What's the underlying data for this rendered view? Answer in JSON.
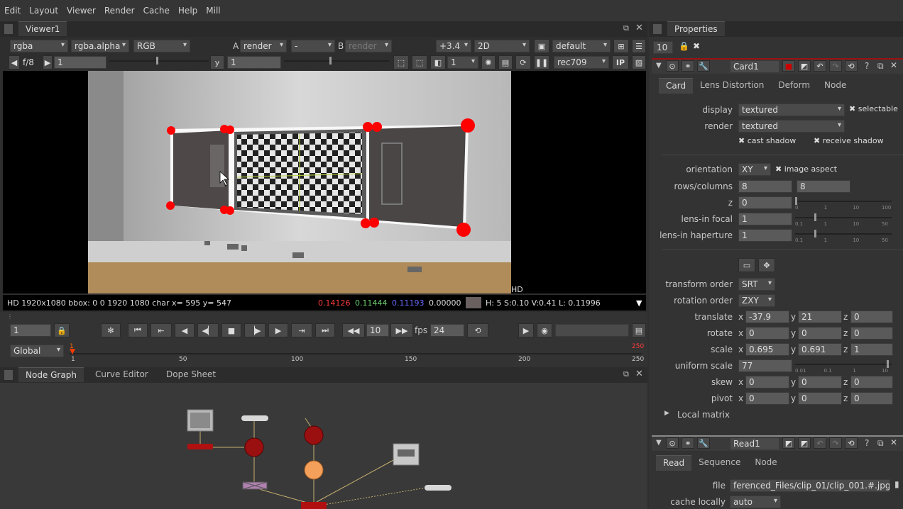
{
  "menu": [
    "Edit",
    "Layout",
    "Viewer",
    "Render",
    "Cache",
    "Help",
    "Mill"
  ],
  "viewer": {
    "tab_label": "Viewer1",
    "channels": "rgba",
    "alpha": "rgba.alpha",
    "colorspace": "RGB",
    "a_label": "A",
    "a_input": "render",
    "a_op": "-",
    "b_label": "B",
    "b_input": "render",
    "gain": "+3.4",
    "view_mode": "2D",
    "lut": "default",
    "fstop": "f/8",
    "frame_field": "1",
    "y_label": "y",
    "y_field": "1",
    "proxy": "1",
    "display_space": "rec709",
    "ip_label": "IP",
    "hd_label": "HD",
    "status_text": "HD 1920x1080 bbox: 0 0 1920 1080 char  x= 595 y= 547",
    "pixel_r": "0.14126",
    "pixel_g": "0.11444",
    "pixel_b": "0.11193",
    "pixel_a": "0.00000",
    "pixel_hsvl": "H:  5 S:0.10 V:0.41  L: 0.11996"
  },
  "playback": {
    "current_frame": "1",
    "step_frames": "10",
    "fps_label": "fps",
    "fps_value": "24",
    "range_mode": "Global",
    "ruler_labels": [
      "1",
      "50",
      "100",
      "150",
      "200",
      "250"
    ],
    "in_point": "1",
    "out_point": "250"
  },
  "bottom_tabs": [
    "Node Graph",
    "Curve Editor",
    "Dope Sheet"
  ],
  "properties": {
    "tab_label": "Properties",
    "max_panels": "10",
    "card_node": {
      "name": "Card1",
      "tabs": [
        "Card",
        "Lens Distortion",
        "Deform",
        "Node"
      ],
      "display_label": "display",
      "display_value": "textured",
      "selectable_label": "selectable",
      "render_label": "render",
      "render_value": "textured",
      "cast_shadow_label": "cast shadow",
      "receive_shadow_label": "receive shadow",
      "orientation_label": "orientation",
      "orientation_value": "XY",
      "image_aspect_label": "image aspect",
      "rows_columns_label": "rows/columns",
      "rows_value": "8",
      "columns_value": "8",
      "z_label": "z",
      "z_value": "0",
      "z_ticks": [
        "0",
        "1",
        "10",
        "100"
      ],
      "z_fraction": 0.0,
      "lens_focal_label": "lens-in focal",
      "lens_focal_value": "1",
      "focal_ticks": [
        "0.1",
        "1",
        "10",
        "50"
      ],
      "focal_fraction": 0.2,
      "lens_haperture_label": "lens-in haperture",
      "lens_haperture_value": "1",
      "haperture_ticks": [
        "0.1",
        "1",
        "10",
        "50"
      ],
      "haperture_fraction": 0.2,
      "transform_order_label": "transform order",
      "transform_order_value": "SRT",
      "rotation_order_label": "rotation order",
      "rotation_order_value": "ZXY",
      "translate_label": "translate",
      "translate": {
        "x": "-37.9",
        "y": "21",
        "z": "0"
      },
      "rotate_label": "rotate",
      "rotate": {
        "x": "0",
        "y": "0",
        "z": "0"
      },
      "scale_label": "scale",
      "scale": {
        "x": "0.695",
        "y": "0.691",
        "z": "1"
      },
      "uniform_scale_label": "uniform scale",
      "uniform_scale_value": "77",
      "uniform_ticks": [
        "0.01",
        "0.1",
        "1",
        "10"
      ],
      "uniform_fraction": 0.97,
      "skew_label": "skew",
      "skew": {
        "x": "0",
        "y": "0",
        "z": "0"
      },
      "pivot_label": "pivot",
      "pivot": {
        "x": "0",
        "y": "0",
        "z": "0"
      },
      "local_matrix_label": "Local matrix",
      "x_axis": "x",
      "y_axis": "y",
      "z_axis": "z"
    },
    "read_node": {
      "name": "Read1",
      "tabs": [
        "Read",
        "Sequence",
        "Node"
      ],
      "file_label": "file",
      "file_value": "ferenced_Files/clip_01/clip_001.#.jpg",
      "cache_label": "cache locally",
      "cache_value": "auto"
    }
  },
  "colors": {
    "accent_red": "#ff0000",
    "red_value": "#ff3b3b",
    "green_value": "#6ad06a",
    "blue_value": "#6a6aff",
    "node_red": "#9a1010",
    "node_orange": "#f4a05a"
  }
}
